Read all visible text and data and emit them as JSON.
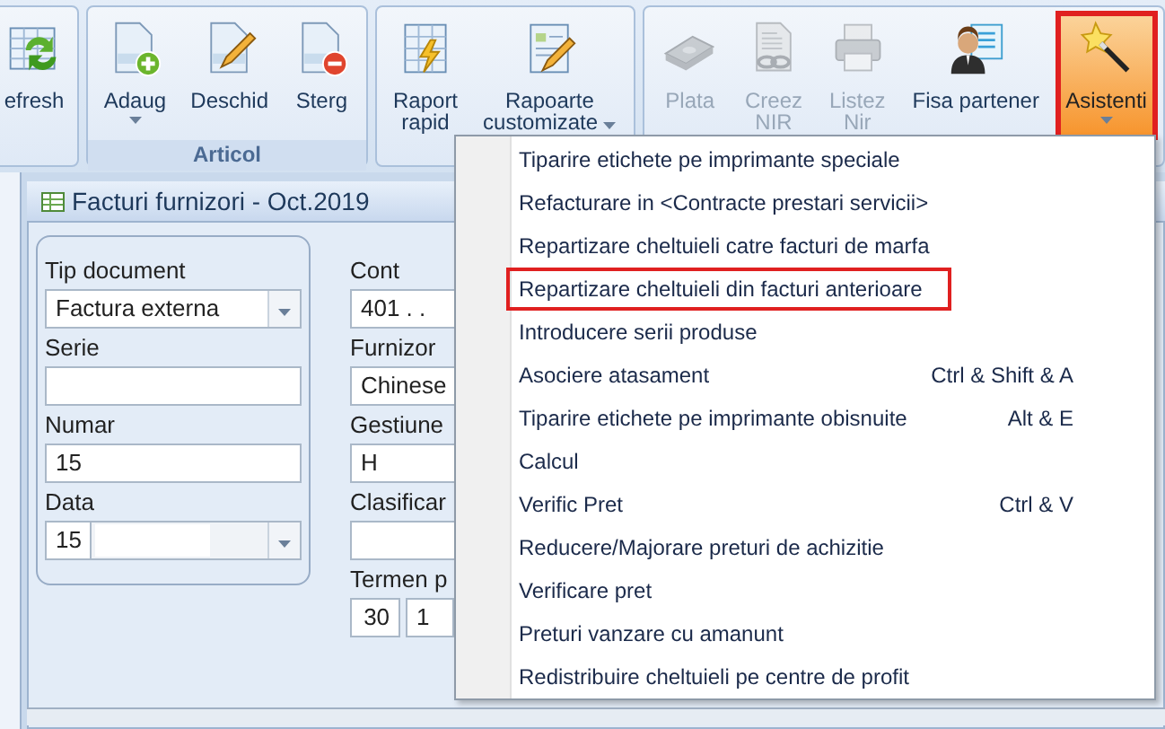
{
  "ribbon": {
    "groups": [
      {
        "buttons": [
          {
            "kind": "refresh",
            "lines": [
              "efresh"
            ],
            "disabled": false,
            "dropdown": false,
            "highlighted": false
          }
        ]
      },
      {
        "label": "Articol",
        "buttons": [
          {
            "kind": "add",
            "lines": [
              "Adaug"
            ],
            "disabled": false,
            "dropdown": true,
            "highlighted": false
          },
          {
            "kind": "edit",
            "lines": [
              "Deschid"
            ],
            "disabled": false,
            "dropdown": false,
            "highlighted": false
          },
          {
            "kind": "delete",
            "lines": [
              "Sterg"
            ],
            "disabled": false,
            "dropdown": false,
            "highlighted": false
          }
        ]
      },
      {
        "buttons": [
          {
            "kind": "report",
            "lines": [
              "Raport",
              "rapid"
            ],
            "disabled": false,
            "dropdown": false,
            "highlighted": false
          },
          {
            "kind": "custom",
            "lines": [
              "Rapoarte",
              "customizate"
            ],
            "disabled": false,
            "dropdown": true,
            "highlighted": false
          }
        ]
      },
      {
        "buttons": [
          {
            "kind": "payment",
            "lines": [
              "Plata"
            ],
            "disabled": true,
            "dropdown": false,
            "highlighted": false
          },
          {
            "kind": "nir",
            "lines": [
              "Creez",
              "NIR"
            ],
            "disabled": true,
            "dropdown": false,
            "highlighted": false
          },
          {
            "kind": "print",
            "lines": [
              "Listez",
              "Nir"
            ],
            "disabled": true,
            "dropdown": false,
            "highlighted": false
          },
          {
            "kind": "partner",
            "lines": [
              "Fisa partener"
            ],
            "disabled": false,
            "dropdown": false,
            "highlighted": false
          },
          {
            "kind": "wizard",
            "lines": [
              "Asistenti"
            ],
            "disabled": false,
            "dropdown": true,
            "highlighted": true
          }
        ]
      }
    ]
  },
  "document": {
    "title": "Facturi furnizori - Oct.2019",
    "left_fields": [
      {
        "kind": "combo",
        "label": "Tip document",
        "value": "Factura externa"
      },
      {
        "kind": "text",
        "label": "Serie"
      },
      {
        "kind": "text",
        "label": "Numar",
        "value": "15"
      },
      {
        "kind": "date",
        "label": "Data",
        "value": "15"
      }
    ],
    "right_fields": [
      {
        "kind": "text",
        "label": "Cont",
        "value": "401 . ."
      },
      {
        "kind": "text",
        "label": "Furnizor",
        "value": "Chinese"
      },
      {
        "kind": "text",
        "label": "Gestiune",
        "value": "H"
      },
      {
        "kind": "text",
        "label": "Clasificar"
      },
      {
        "kind": "pair",
        "label": "Termen p",
        "values": [
          "30",
          "1"
        ]
      }
    ]
  },
  "menu": {
    "items": [
      {
        "label": "Tiparire etichete pe imprimante speciale",
        "highlighted": false
      },
      {
        "label": "Refacturare in <Contracte prestari servicii>",
        "highlighted": false
      },
      {
        "label": "Repartizare cheltuieli catre facturi de marfa",
        "highlighted": false
      },
      {
        "label": "Repartizare cheltuieli din facturi anterioare",
        "highlighted": true
      },
      {
        "label": "Introducere serii produse",
        "highlighted": false
      },
      {
        "label": "Asociere atasament",
        "shortcut": "Ctrl & Shift & A",
        "highlighted": false
      },
      {
        "label": "Tiparire etichete pe imprimante obisnuite",
        "shortcut": "Alt & E",
        "highlighted": false
      },
      {
        "label": "Calcul",
        "highlighted": false
      },
      {
        "label": "Verific Pret",
        "shortcut": "Ctrl & V",
        "highlighted": false
      },
      {
        "label": "Reducere/Majorare preturi de achizitie",
        "highlighted": false
      },
      {
        "label": "Verificare pret",
        "highlighted": false
      },
      {
        "label": "Preturi vanzare cu amanunt",
        "highlighted": false
      },
      {
        "label": "Redistribuire cheltuieli pe centre de profit",
        "highlighted": false
      }
    ]
  }
}
